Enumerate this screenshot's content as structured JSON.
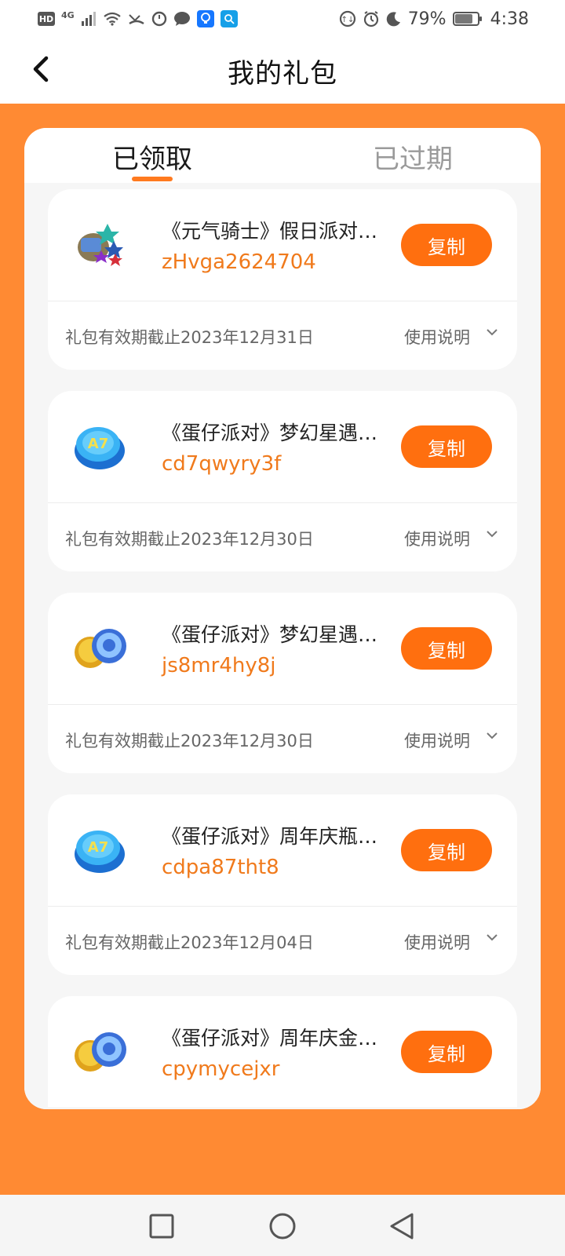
{
  "status_bar": {
    "hd": "HD",
    "network": "4G",
    "battery_percent": "79%",
    "battery_level": 0.79,
    "time": "4:38"
  },
  "header": {
    "title": "我的礼包",
    "back_icon": "chevron-left-icon"
  },
  "tabs": [
    {
      "label": "已领取",
      "active": true
    },
    {
      "label": "已过期",
      "active": false
    }
  ],
  "gifts": [
    {
      "title": "《元气骑士》假日派对…",
      "code": "zHvga2624704",
      "copy_label": "复制",
      "expiry": "礼包有效期截止2023年12月31日",
      "usage_label": "使用说明",
      "icon": "gift-pack-icon"
    },
    {
      "title": "《蛋仔派对》梦幻星遇…",
      "code": "cd7qwyry3f",
      "copy_label": "复制",
      "expiry": "礼包有效期截止2023年12月30日",
      "usage_label": "使用说明",
      "icon": "bottle-cap-icon"
    },
    {
      "title": "《蛋仔派对》梦幻星遇…",
      "code": "js8mr4hy8j",
      "copy_label": "复制",
      "expiry": "礼包有效期截止2023年12月30日",
      "usage_label": "使用说明",
      "icon": "coins-icon"
    },
    {
      "title": "《蛋仔派对》周年庆瓶…",
      "code": "cdpa87tht8",
      "copy_label": "复制",
      "expiry": "礼包有效期截止2023年12月04日",
      "usage_label": "使用说明",
      "icon": "bottle-cap-icon"
    },
    {
      "title": "《蛋仔派对》周年庆金…",
      "code": "cpymycejxr",
      "copy_label": "复制",
      "expiry": "",
      "usage_label": "",
      "icon": "coins-icon"
    }
  ],
  "colors": {
    "accent": "#FF6F0F",
    "background": "#FF8A33",
    "code_text": "#F07A1C"
  }
}
